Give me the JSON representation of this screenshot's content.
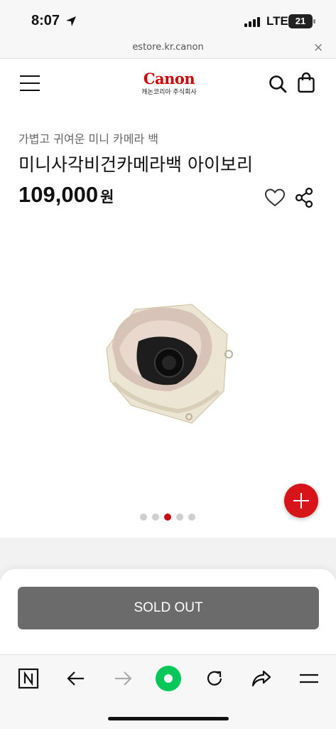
{
  "status_bar": {
    "time": "8:07",
    "network": "LTE",
    "battery": "21"
  },
  "browser": {
    "url": "estore.kr.canon",
    "close_symbol": "×"
  },
  "header": {
    "logo": "Canon",
    "logo_sub": "캐논코리아 주식회사"
  },
  "product": {
    "subtitle": "가볍고 귀여운 미니 카메라 백",
    "title": "미니사각비건카메라백 아이보리",
    "price": "109,000",
    "currency": "원",
    "image_count": 5,
    "active_image_index": 2
  },
  "action": {
    "sold_out_label": "SOLD OUT"
  },
  "colors": {
    "accent": "#d7141a",
    "brand": "#cc0000",
    "sold_out_bg": "#6b6b6b",
    "naver_green": "#03c75a"
  }
}
